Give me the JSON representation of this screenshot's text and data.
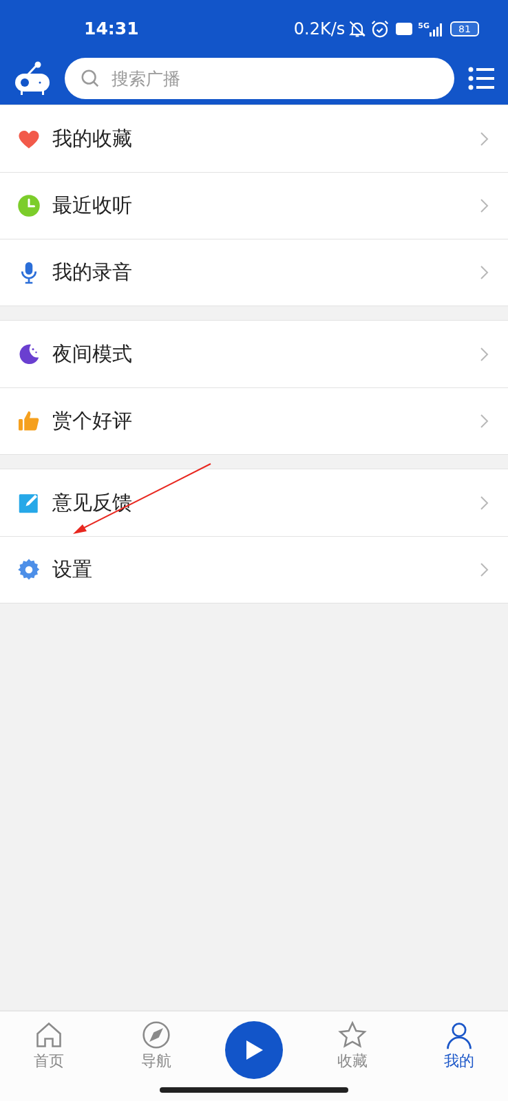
{
  "status_bar": {
    "time": "14:31",
    "net_speed": "0.2K/s",
    "network": "5G",
    "battery": "81"
  },
  "search": {
    "placeholder": "搜索广播"
  },
  "menu_groups": [
    {
      "items": [
        {
          "label": "我的收藏"
        },
        {
          "label": "最近收听"
        },
        {
          "label": "我的录音"
        }
      ]
    },
    {
      "items": [
        {
          "label": "夜间模式"
        },
        {
          "label": "赏个好评"
        }
      ]
    },
    {
      "items": [
        {
          "label": "意见反馈"
        },
        {
          "label": "设置"
        }
      ]
    }
  ],
  "bottom_nav": [
    {
      "label": "首页",
      "selected": false
    },
    {
      "label": "导航",
      "selected": false
    },
    {
      "label": "收藏",
      "selected": false
    },
    {
      "label": "我的",
      "selected": true
    }
  ]
}
